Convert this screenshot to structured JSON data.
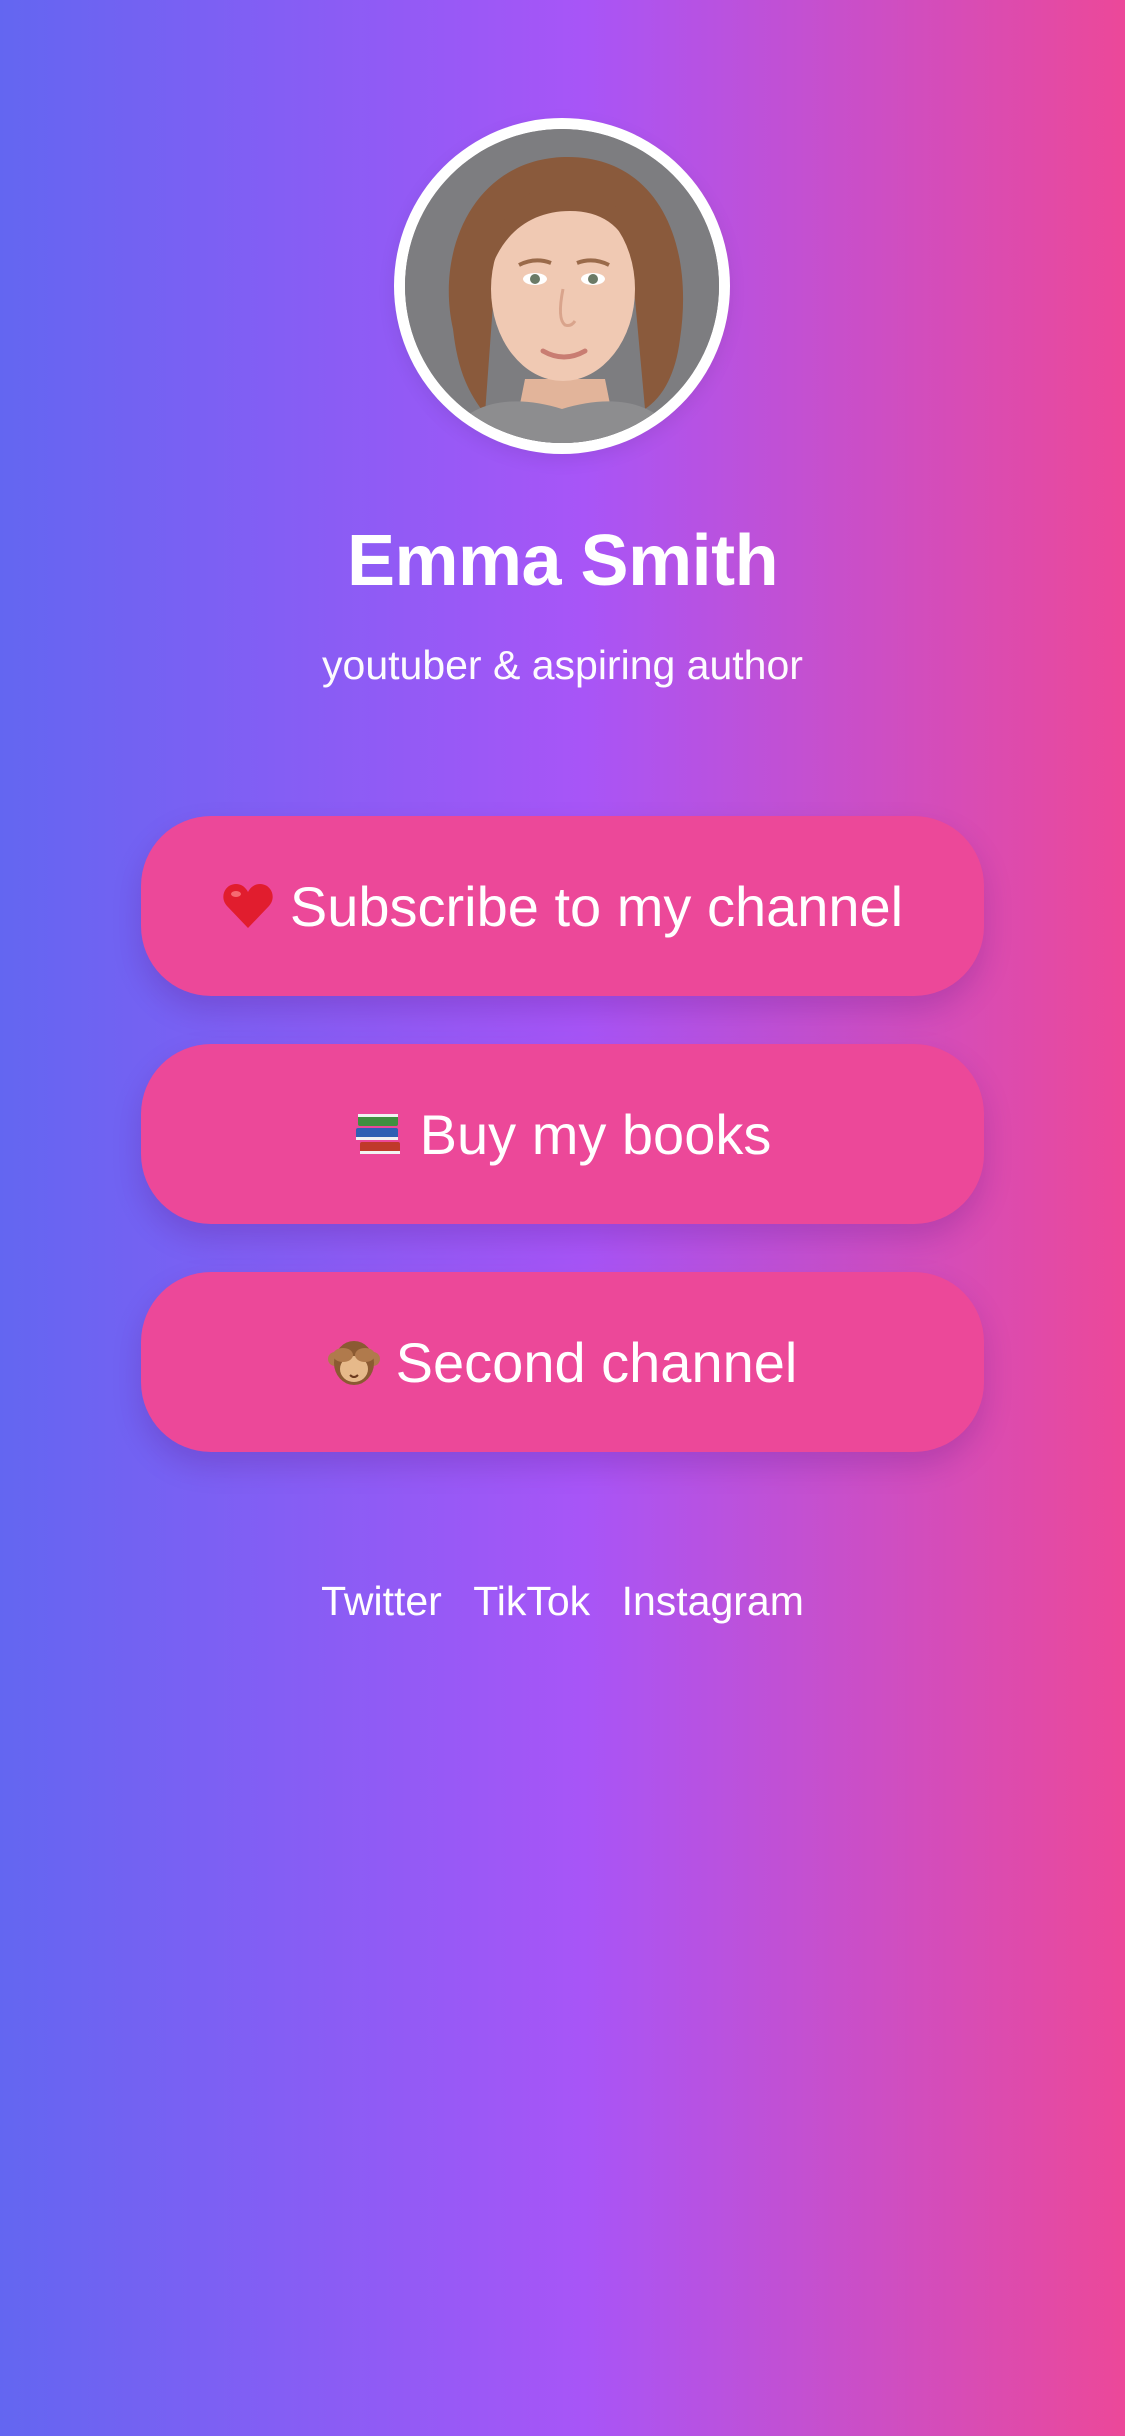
{
  "profile": {
    "name": "Emma Smith",
    "bio": "youtuber & aspiring author"
  },
  "links": [
    {
      "icon": "red-heart-icon",
      "label": "Subscribe to my channel"
    },
    {
      "icon": "books-icon",
      "label": "Buy my books"
    },
    {
      "icon": "see-no-evil-monkey-icon",
      "label": "Second channel"
    }
  ],
  "socials": [
    {
      "label": "Twitter"
    },
    {
      "label": "TikTok"
    },
    {
      "label": "Instagram"
    }
  ],
  "colors": {
    "gradient_start": "#6366f1",
    "gradient_mid": "#a855f7",
    "gradient_end": "#ec4899",
    "button": "#ec4899",
    "text": "#ffffff"
  }
}
